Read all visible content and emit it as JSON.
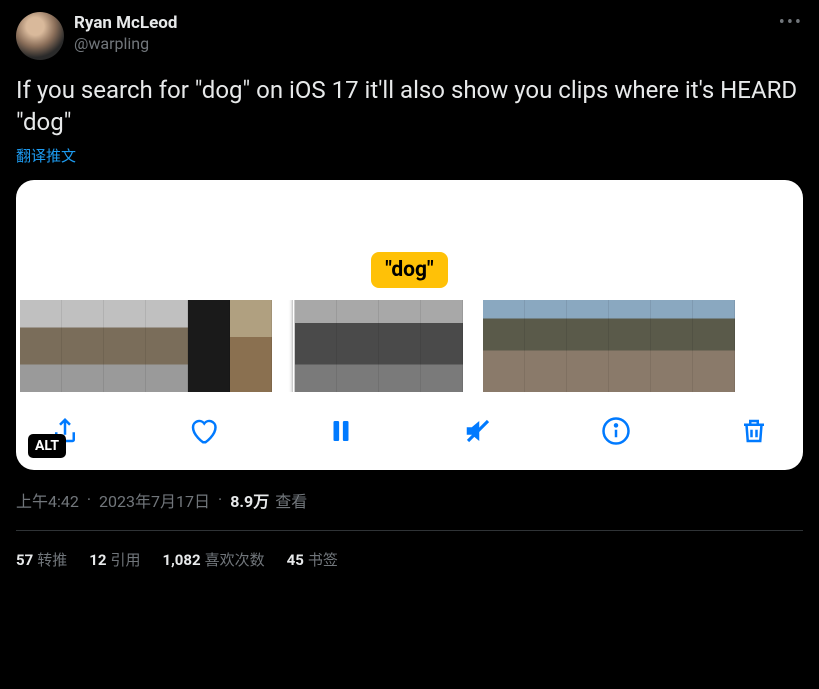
{
  "author": {
    "display_name": "Ryan McLeod",
    "handle": "@warpling"
  },
  "tweet_text": "If you search for \"dog\" on iOS 17 it'll also show you clips where it's HEARD \"dog\"",
  "translate_label": "翻译推文",
  "media": {
    "caption_text": "\"dog\"",
    "alt_badge": "ALT"
  },
  "meta": {
    "time": "上午4:42",
    "date": "2023年7月17日",
    "views_count": "8.9万",
    "views_label": "查看"
  },
  "stats": {
    "retweets": {
      "count": "57",
      "label": "转推"
    },
    "quotes": {
      "count": "12",
      "label": "引用"
    },
    "likes": {
      "count": "1,082",
      "label": "喜欢次数"
    },
    "bookmarks": {
      "count": "45",
      "label": "书签"
    }
  }
}
